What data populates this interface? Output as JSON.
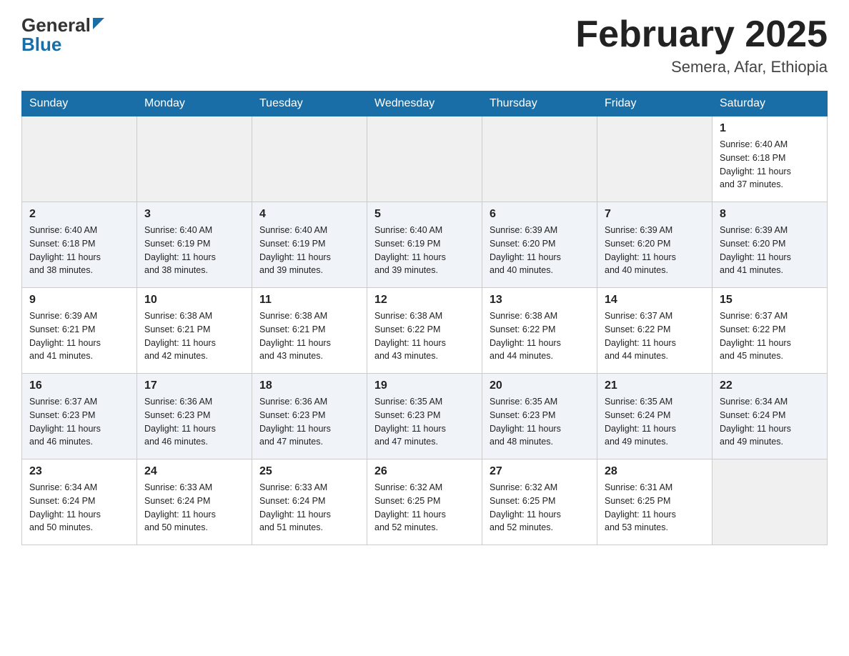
{
  "header": {
    "logo_general": "General",
    "logo_blue": "Blue",
    "month_title": "February 2025",
    "location": "Semera, Afar, Ethiopia"
  },
  "days_of_week": [
    "Sunday",
    "Monday",
    "Tuesday",
    "Wednesday",
    "Thursday",
    "Friday",
    "Saturday"
  ],
  "weeks": [
    [
      {
        "day": "",
        "info": ""
      },
      {
        "day": "",
        "info": ""
      },
      {
        "day": "",
        "info": ""
      },
      {
        "day": "",
        "info": ""
      },
      {
        "day": "",
        "info": ""
      },
      {
        "day": "",
        "info": ""
      },
      {
        "day": "1",
        "info": "Sunrise: 6:40 AM\nSunset: 6:18 PM\nDaylight: 11 hours\nand 37 minutes."
      }
    ],
    [
      {
        "day": "2",
        "info": "Sunrise: 6:40 AM\nSunset: 6:18 PM\nDaylight: 11 hours\nand 38 minutes."
      },
      {
        "day": "3",
        "info": "Sunrise: 6:40 AM\nSunset: 6:19 PM\nDaylight: 11 hours\nand 38 minutes."
      },
      {
        "day": "4",
        "info": "Sunrise: 6:40 AM\nSunset: 6:19 PM\nDaylight: 11 hours\nand 39 minutes."
      },
      {
        "day": "5",
        "info": "Sunrise: 6:40 AM\nSunset: 6:19 PM\nDaylight: 11 hours\nand 39 minutes."
      },
      {
        "day": "6",
        "info": "Sunrise: 6:39 AM\nSunset: 6:20 PM\nDaylight: 11 hours\nand 40 minutes."
      },
      {
        "day": "7",
        "info": "Sunrise: 6:39 AM\nSunset: 6:20 PM\nDaylight: 11 hours\nand 40 minutes."
      },
      {
        "day": "8",
        "info": "Sunrise: 6:39 AM\nSunset: 6:20 PM\nDaylight: 11 hours\nand 41 minutes."
      }
    ],
    [
      {
        "day": "9",
        "info": "Sunrise: 6:39 AM\nSunset: 6:21 PM\nDaylight: 11 hours\nand 41 minutes."
      },
      {
        "day": "10",
        "info": "Sunrise: 6:38 AM\nSunset: 6:21 PM\nDaylight: 11 hours\nand 42 minutes."
      },
      {
        "day": "11",
        "info": "Sunrise: 6:38 AM\nSunset: 6:21 PM\nDaylight: 11 hours\nand 43 minutes."
      },
      {
        "day": "12",
        "info": "Sunrise: 6:38 AM\nSunset: 6:22 PM\nDaylight: 11 hours\nand 43 minutes."
      },
      {
        "day": "13",
        "info": "Sunrise: 6:38 AM\nSunset: 6:22 PM\nDaylight: 11 hours\nand 44 minutes."
      },
      {
        "day": "14",
        "info": "Sunrise: 6:37 AM\nSunset: 6:22 PM\nDaylight: 11 hours\nand 44 minutes."
      },
      {
        "day": "15",
        "info": "Sunrise: 6:37 AM\nSunset: 6:22 PM\nDaylight: 11 hours\nand 45 minutes."
      }
    ],
    [
      {
        "day": "16",
        "info": "Sunrise: 6:37 AM\nSunset: 6:23 PM\nDaylight: 11 hours\nand 46 minutes."
      },
      {
        "day": "17",
        "info": "Sunrise: 6:36 AM\nSunset: 6:23 PM\nDaylight: 11 hours\nand 46 minutes."
      },
      {
        "day": "18",
        "info": "Sunrise: 6:36 AM\nSunset: 6:23 PM\nDaylight: 11 hours\nand 47 minutes."
      },
      {
        "day": "19",
        "info": "Sunrise: 6:35 AM\nSunset: 6:23 PM\nDaylight: 11 hours\nand 47 minutes."
      },
      {
        "day": "20",
        "info": "Sunrise: 6:35 AM\nSunset: 6:23 PM\nDaylight: 11 hours\nand 48 minutes."
      },
      {
        "day": "21",
        "info": "Sunrise: 6:35 AM\nSunset: 6:24 PM\nDaylight: 11 hours\nand 49 minutes."
      },
      {
        "day": "22",
        "info": "Sunrise: 6:34 AM\nSunset: 6:24 PM\nDaylight: 11 hours\nand 49 minutes."
      }
    ],
    [
      {
        "day": "23",
        "info": "Sunrise: 6:34 AM\nSunset: 6:24 PM\nDaylight: 11 hours\nand 50 minutes."
      },
      {
        "day": "24",
        "info": "Sunrise: 6:33 AM\nSunset: 6:24 PM\nDaylight: 11 hours\nand 50 minutes."
      },
      {
        "day": "25",
        "info": "Sunrise: 6:33 AM\nSunset: 6:24 PM\nDaylight: 11 hours\nand 51 minutes."
      },
      {
        "day": "26",
        "info": "Sunrise: 6:32 AM\nSunset: 6:25 PM\nDaylight: 11 hours\nand 52 minutes."
      },
      {
        "day": "27",
        "info": "Sunrise: 6:32 AM\nSunset: 6:25 PM\nDaylight: 11 hours\nand 52 minutes."
      },
      {
        "day": "28",
        "info": "Sunrise: 6:31 AM\nSunset: 6:25 PM\nDaylight: 11 hours\nand 53 minutes."
      },
      {
        "day": "",
        "info": ""
      }
    ]
  ]
}
